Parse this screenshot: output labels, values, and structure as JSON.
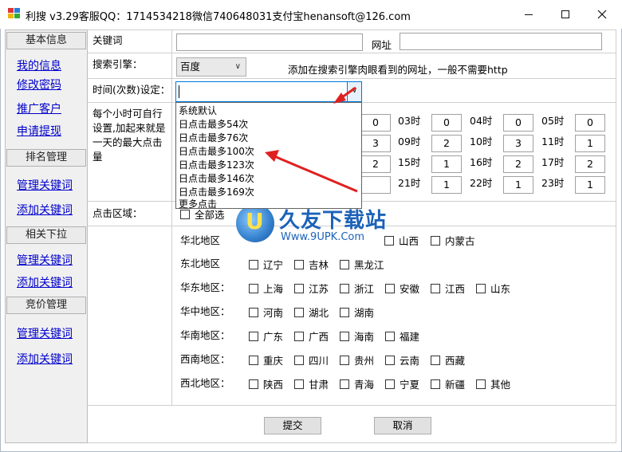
{
  "window": {
    "title": "利搜 v3.29客服QQ：1714534218微信740648031支付宝henansoft@126.com"
  },
  "sidebar": {
    "sections": [
      {
        "header": "基本信息",
        "links": [
          "我的信息",
          "修改密码",
          "推广客户",
          "申请提现"
        ]
      },
      {
        "header": "排名管理",
        "links": [
          "管理关键词",
          "添加关键词"
        ]
      },
      {
        "header": "相关下拉",
        "links": [
          "管理关键词",
          "添加关键词"
        ]
      },
      {
        "header": "竞价管理",
        "links": [
          "管理关键词",
          "添加关键词"
        ]
      }
    ]
  },
  "form": {
    "keyword_label": "关键词",
    "url_label": "网址",
    "engine_label": "搜索引擎：",
    "engine_value": "百度",
    "engine_note": "添加在搜索引擎肉眼看到的网址，一般不需要http",
    "time_label": "时间(次数)设定：",
    "hourly_desc": "每个小时可自行设置,加起来就是一天的最大点击量",
    "click_area_label": "点击区域：",
    "click_all_label": "全部选"
  },
  "dropdown": {
    "options": [
      "系统默认",
      "日点击最多54次",
      "日点击最多76次",
      "日点击最多100次",
      "日点击最多123次",
      "日点击最多146次",
      "日点击最多169次",
      "更多点击"
    ]
  },
  "hours": [
    {
      "label": "03时",
      "value": "0"
    },
    {
      "label": "04时",
      "value": "0"
    },
    {
      "label": "05时",
      "value": "0"
    },
    {
      "label": "09时",
      "value": "2"
    },
    {
      "label": "10时",
      "value": "3"
    },
    {
      "label": "11时",
      "value": "1"
    },
    {
      "label": "15时",
      "value": "1"
    },
    {
      "label": "16时",
      "value": "2"
    },
    {
      "label": "17时",
      "value": "2"
    },
    {
      "label": "21时",
      "value": "1"
    },
    {
      "label": "22时",
      "value": "1"
    },
    {
      "label": "23时",
      "value": "1"
    }
  ],
  "partial_hour_values": [
    "0",
    "3",
    "2"
  ],
  "regions": [
    {
      "label": "华北地区",
      "items": [
        "山西",
        "内蒙古"
      ]
    },
    {
      "label": "东北地区",
      "items": [
        "辽宁",
        "吉林",
        "黑龙江"
      ]
    },
    {
      "label": "华东地区：",
      "items": [
        "上海",
        "江苏",
        "浙江",
        "安徽",
        "江西",
        "山东"
      ]
    },
    {
      "label": "华中地区：",
      "items": [
        "河南",
        "湖北",
        "湖南"
      ]
    },
    {
      "label": "华南地区：",
      "items": [
        "广东",
        "广西",
        "海南",
        "福建"
      ]
    },
    {
      "label": "西南地区：",
      "items": [
        "重庆",
        "四川",
        "贵州",
        "云南",
        "西藏"
      ]
    },
    {
      "label": "西北地区：",
      "items": [
        "陕西",
        "甘肃",
        "青海",
        "宁夏",
        "新疆",
        "其他"
      ]
    }
  ],
  "buttons": {
    "submit": "提交",
    "cancel": "取消"
  },
  "watermark": {
    "title": "久友下载站",
    "url": "Www.9UPK.Com"
  },
  "colors": {
    "link": "#0000cc",
    "accent": "#0078d7",
    "arrow": "#e02020",
    "watermark": "#1c62b8"
  }
}
